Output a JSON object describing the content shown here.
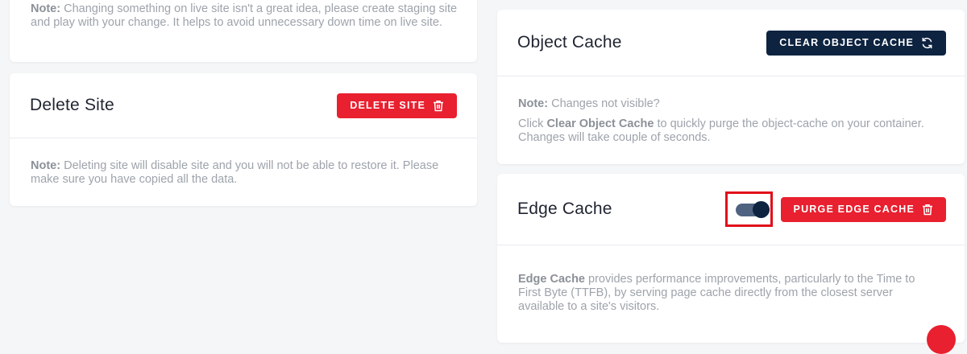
{
  "live_site_card": {
    "note_label": "Note:",
    "note_text": " Changing something on live site isn't a great idea, please create staging site and play with your change. It helps to avoid unnecessary down time on live site."
  },
  "delete_site_card": {
    "title": "Delete Site",
    "button_label": "DELETE SITE",
    "note_label": "Note:",
    "note_text": " Deleting site will disable site and you will not be able to restore it. Please make sure you have copied all the data."
  },
  "object_cache_card": {
    "title": "Object Cache",
    "button_label": "CLEAR OBJECT CACHE",
    "note_label": "Note:",
    "note_text": " Changes not visible?",
    "desc_prefix": "Click ",
    "desc_bold": "Clear Object Cache",
    "desc_suffix": " to quickly purge the object-cache on your container. Changes will take couple of seconds."
  },
  "edge_cache_card": {
    "title": "Edge Cache",
    "toggle_state": "on",
    "button_label": "PURGE EDGE CACHE",
    "desc_bold": "Edge Cache",
    "desc_text": " provides performance improvements, particularly to the Time to First Byte (TTFB), by serving page cache directly from the closest server available to a site's visitors."
  },
  "colors": {
    "danger": "#e8202f",
    "navy": "#0d2340",
    "highlight": "#e0101a"
  },
  "icons": [
    "trash-icon",
    "refresh-icon"
  ]
}
